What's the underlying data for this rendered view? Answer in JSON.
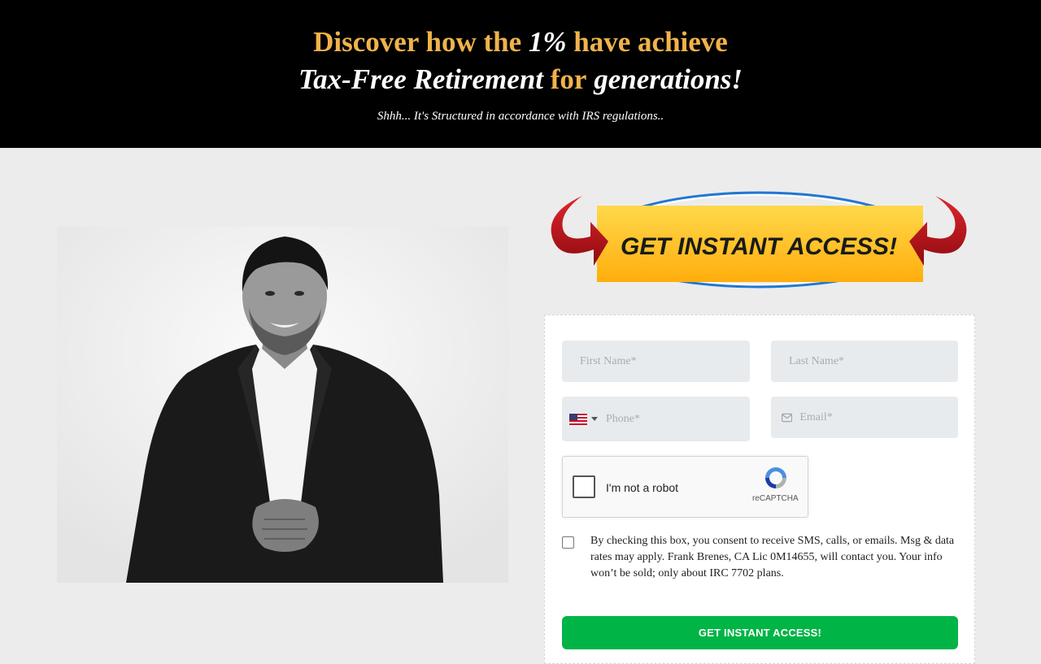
{
  "hero": {
    "line1_a": "Discover how the ",
    "line1_b": "1%",
    "line1_c": " have achieve",
    "line2_a": "Tax-Free Retirement ",
    "line2_b": "for",
    "line2_c": " generations!",
    "subtitle": "Shhh... It's Structured in accordance with IRS regulations.."
  },
  "cta_banner": {
    "label": "GET INSTANT ACCESS!"
  },
  "form": {
    "first_name_placeholder": "First Name*",
    "last_name_placeholder": "Last Name*",
    "phone_placeholder": "Phone*",
    "email_placeholder": "Email*",
    "phone_country": "US",
    "captcha_label": "I'm not a robot",
    "captcha_brand": "reCAPTCHA",
    "consent_text": "By checking this box, you consent to receive SMS, calls, or emails. Msg & data rates may apply. Frank Brenes, CA Lic 0M14655, will contact you. Your info won’t be sold; only about IRC 7702 plans.",
    "submit_label": "GET INSTANT ACCESS!"
  },
  "colors": {
    "accent_gold": "#f0b34a",
    "button_green": "#00b446",
    "banner_yellow": "#ffc21a",
    "arrow_red": "#c0141a"
  }
}
